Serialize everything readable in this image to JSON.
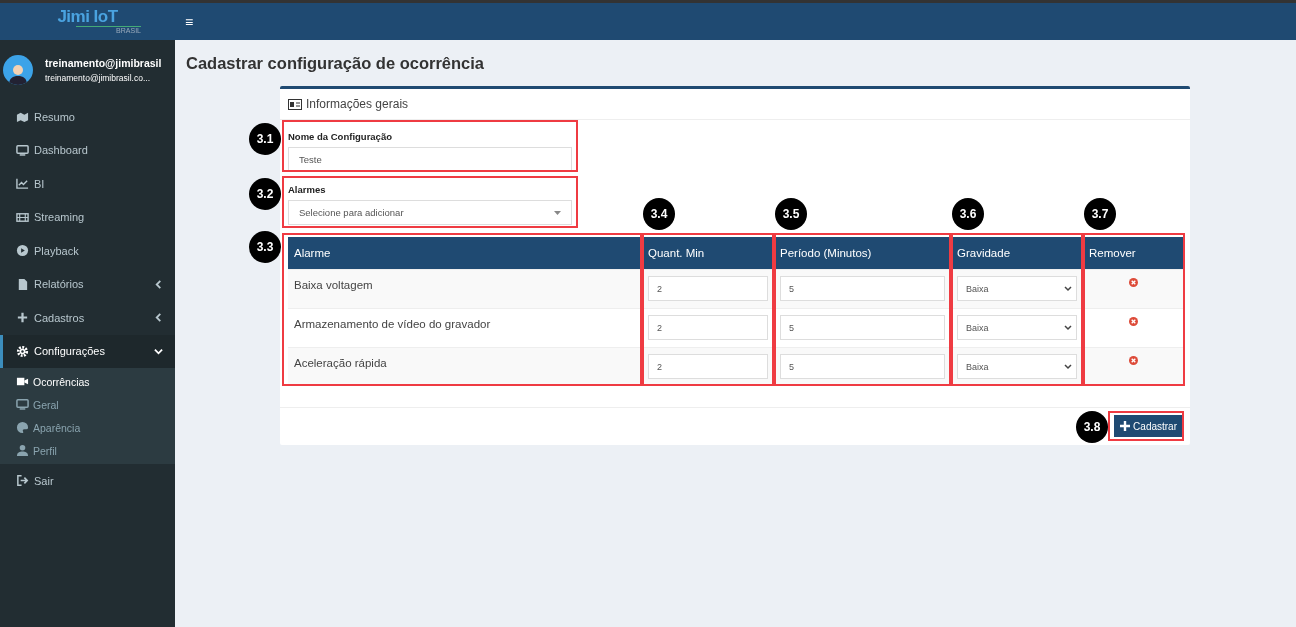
{
  "brand": {
    "name": "Jimi IoT",
    "sub": "BRASIL"
  },
  "menu_glyph": "≡",
  "user": {
    "name": "treinamento@jimibrasil",
    "email": "treinamento@jimibrasil.co..."
  },
  "sidebar": {
    "items": [
      {
        "label": "Resumo",
        "selected": false
      },
      {
        "label": "Dashboard",
        "selected": false
      },
      {
        "label": "BI",
        "selected": false
      },
      {
        "label": "Streaming",
        "selected": false
      },
      {
        "label": "Playback",
        "selected": false
      },
      {
        "label": "Relatórios",
        "selected": false,
        "expanded": false
      },
      {
        "label": "Cadastros",
        "selected": false,
        "expanded": false
      },
      {
        "label": "Configurações",
        "selected": true,
        "expanded": true,
        "children": [
          {
            "label": "Ocorrências",
            "selected": true
          },
          {
            "label": "Geral",
            "selected": false
          },
          {
            "label": "Aparência",
            "selected": false
          },
          {
            "label": "Perfil",
            "selected": false
          }
        ]
      },
      {
        "label": "Sair",
        "selected": false
      }
    ]
  },
  "page_title": "Cadastrar configuração de ocorrência",
  "card": {
    "title": "Informações gerais",
    "name_field": {
      "label": "Nome da Configuração",
      "value": "Teste"
    },
    "alarms_field": {
      "label": "Alarmes",
      "placeholder": "Selecione para adicionar"
    },
    "table": {
      "columns": [
        "Alarme",
        "Quant. Min",
        "Período (Minutos)",
        "Gravidade",
        "Remover"
      ],
      "rows": [
        {
          "alarm": "Baixa voltagem",
          "quantity": "2",
          "period": "5",
          "severity": "Baixa"
        },
        {
          "alarm": "Armazenamento de vídeo do gravador",
          "quantity": "2",
          "period": "5",
          "severity": "Baixa"
        },
        {
          "alarm": "Aceleração rápida",
          "quantity": "2",
          "period": "5",
          "severity": "Baixa"
        }
      ]
    },
    "submit_button": "Cadastrar"
  },
  "annotations": [
    "3.1",
    "3.2",
    "3.3",
    "3.4",
    "3.5",
    "3.6",
    "3.7",
    "3.8"
  ]
}
